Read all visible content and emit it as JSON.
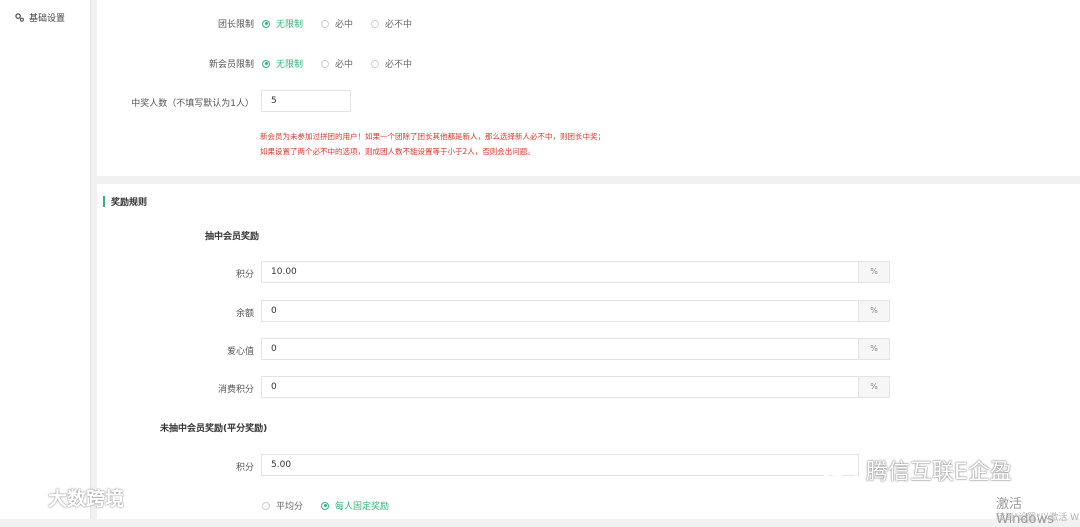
{
  "sidebar": {
    "item_label": "基础设置"
  },
  "form1": {
    "leader_limit": {
      "label": "团长限制",
      "options": [
        "无限制",
        "必中",
        "必不中"
      ],
      "selected": "无限制"
    },
    "new_member_limit": {
      "label": "新会员限制",
      "options": [
        "无限制",
        "必中",
        "必不中"
      ],
      "selected": "无限制"
    },
    "winner_count": {
      "label": "中奖人数（不填写默认为1人）",
      "value": "5"
    },
    "notes": [
      "新会员为未参加过拼团的用户！如果一个团除了团长其他都是新人，那么选择新人必不中，则团长中奖；",
      "如果设置了两个必不中的选项，则成团人数不能设置等于小于2人，否则会出问题。"
    ]
  },
  "rewards": {
    "section_title": "奖励规则",
    "winner_title": "抽中会员奖励",
    "winner_fields": [
      {
        "label": "积分",
        "value": "10.00",
        "suffix": "%"
      },
      {
        "label": "余额",
        "value": "0",
        "suffix": "%"
      },
      {
        "label": "爱心值",
        "value": "0",
        "suffix": "%"
      },
      {
        "label": "消费积分",
        "value": "0",
        "suffix": "%"
      }
    ],
    "loser_title": "未抽中会员奖励(平分奖励)",
    "loser_points": {
      "label": "积分",
      "value": "5.00"
    },
    "split_mode": {
      "options": [
        "平均分",
        "每人固定奖励"
      ],
      "selected": "每人固定奖励"
    }
  },
  "watermarks": {
    "left": "大数跨境",
    "right": "腾信互联E企盈"
  },
  "windows_activation": {
    "line1": "激活 Windows",
    "line2": "转到\"设置\"以激活 W"
  },
  "colors": {
    "accent": "#31b67a",
    "note": "#e0362a"
  }
}
